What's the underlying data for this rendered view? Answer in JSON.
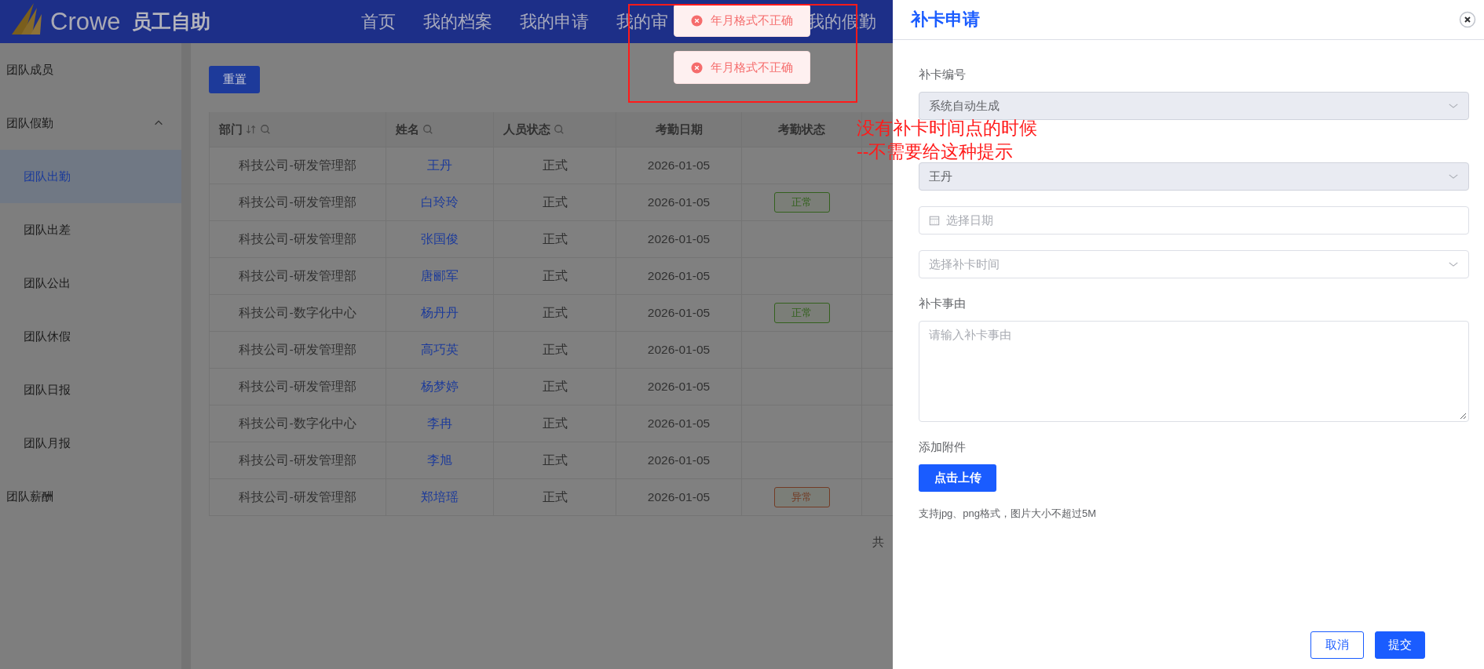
{
  "header": {
    "logo_text": "Crowe",
    "app_title": "员工自助",
    "nav": [
      {
        "label": "首页"
      },
      {
        "label": "我的档案"
      },
      {
        "label": "我的申请"
      },
      {
        "label": "我的审"
      },
      {
        "label": "我的假勤"
      }
    ]
  },
  "sidebar": {
    "items": [
      {
        "kind": "link",
        "label": "团队成员",
        "selected": false
      },
      {
        "kind": "group",
        "label": "团队假勤",
        "selected": false,
        "expanded": true,
        "children": [
          {
            "label": "团队出勤",
            "selected": true
          },
          {
            "label": "团队出差",
            "selected": false
          },
          {
            "label": "团队公出",
            "selected": false
          },
          {
            "label": "团队休假",
            "selected": false
          },
          {
            "label": "团队日报",
            "selected": false
          },
          {
            "label": "团队月报",
            "selected": false
          }
        ]
      },
      {
        "kind": "link",
        "label": "团队薪酬",
        "selected": false
      }
    ]
  },
  "toolbar": {
    "reset_button": "重置"
  },
  "table": {
    "columns": [
      {
        "label": "部门",
        "sortable": true,
        "searchable": true
      },
      {
        "label": "姓名",
        "sortable": false,
        "searchable": true
      },
      {
        "label": "人员状态",
        "sortable": false,
        "searchable": true
      },
      {
        "label": "考勤日期",
        "sortable": false,
        "searchable": false
      },
      {
        "label": "考勤状态",
        "sortable": false,
        "searchable": false
      }
    ],
    "rows": [
      {
        "department": "科技公司-研发管理部",
        "name": "王丹",
        "person_status": "正式",
        "date": "2026-01-05"
      },
      {
        "department": "科技公司-研发管理部",
        "name": "白玲玲",
        "person_status": "正式",
        "date": "2026-01-05",
        "attendance_status": {
          "text": "正常",
          "color": "#33611d"
        }
      },
      {
        "department": "科技公司-研发管理部",
        "name": "张国俊",
        "person_status": "正式",
        "date": "2026-01-05"
      },
      {
        "department": "科技公司-研发管理部",
        "name": "唐郦军",
        "person_status": "正式",
        "date": "2026-01-05"
      },
      {
        "department": "科技公司-数字化中心",
        "name": "杨丹丹",
        "person_status": "正式",
        "date": "2026-01-05",
        "attendance_status": {
          "text": "正常",
          "color": "#33611d"
        }
      },
      {
        "department": "科技公司-研发管理部",
        "name": "高巧英",
        "person_status": "正式",
        "date": "2026-01-05"
      },
      {
        "department": "科技公司-研发管理部",
        "name": "杨梦婷",
        "person_status": "正式",
        "date": "2026-01-05"
      },
      {
        "department": "科技公司-数字化中心",
        "name": "李冉",
        "person_status": "正式",
        "date": "2026-01-05"
      },
      {
        "department": "科技公司-研发管理部",
        "name": "李旭",
        "person_status": "正式",
        "date": "2026-01-05"
      },
      {
        "department": "科技公司-研发管理部",
        "name": "郑培瑶",
        "person_status": "正式",
        "date": "2026-01-05",
        "attendance_status": {
          "text": "异常",
          "color": "#733c25"
        }
      }
    ]
  },
  "pagination": {
    "total_text": "共"
  },
  "toasts": [
    {
      "message": "年月格式不正确"
    },
    {
      "message": "年月格式不正确"
    }
  ],
  "annotation": {
    "lines": [
      "没有补卡时间点的时候",
      "--不需要给这种提示"
    ]
  },
  "drawer": {
    "title": "补卡申请",
    "fields": [
      {
        "kind": "select",
        "label": "补卡编号",
        "value": "系统自动生成",
        "disabled": true
      },
      {
        "kind": "select",
        "value": "王丹",
        "disabled": true
      },
      {
        "kind": "date",
        "placeholder": "选择日期",
        "disabled": false
      },
      {
        "kind": "select",
        "placeholder": "选择补卡时间",
        "disabled": false
      },
      {
        "kind": "textarea",
        "label": "补卡事由",
        "placeholder": "请输入补卡事由",
        "disabled": false
      },
      {
        "kind": "upload",
        "label": "添加附件",
        "button": "点击上传",
        "hint": "支持jpg、png格式，图片大小不超过5M"
      }
    ],
    "buttons": [
      {
        "label": "取消",
        "kind": "secondary"
      },
      {
        "label": "提交",
        "kind": "primary"
      }
    ]
  }
}
